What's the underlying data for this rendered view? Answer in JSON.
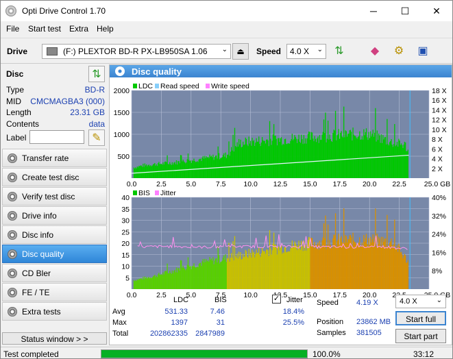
{
  "window": {
    "title": "Opti Drive Control 1.70",
    "minimize": "─",
    "maximize": "☐",
    "close": "✕"
  },
  "menu": [
    "File",
    "Start test",
    "Extra",
    "Help"
  ],
  "toolbar": {
    "drive_label": "Drive",
    "drive_value": "(F:)  PLEXTOR BD-R  PX-LB950SA 1.06",
    "speed_label": "Speed",
    "speed_value": "4.0 X"
  },
  "sidebar": {
    "disc_title": "Disc",
    "info": [
      {
        "k": "Type",
        "v": "BD-R"
      },
      {
        "k": "MID",
        "v": "CMCMAGBA3 (000)"
      },
      {
        "k": "Length",
        "v": "23.31 GB"
      },
      {
        "k": "Contents",
        "v": "data"
      }
    ],
    "label_key": "Label",
    "nav": [
      "Transfer rate",
      "Create test disc",
      "Verify test disc",
      "Drive info",
      "Disc info",
      "Disc quality",
      "CD Bler",
      "FE / TE",
      "Extra tests"
    ],
    "active_index": 5,
    "status_window": "Status window > >"
  },
  "panel": {
    "title": "Disc quality"
  },
  "chart_data": [
    {
      "type": "area",
      "legend": [
        "LDC",
        "Read speed",
        "Write speed"
      ],
      "colors": {
        "LDC": "#00c800",
        "Read speed": "#87cefa",
        "Write speed": "#ff80ff"
      },
      "x_ticks": [
        "0.0",
        "2.5",
        "5.0",
        "7.5",
        "10.0",
        "12.5",
        "15.0",
        "17.5",
        "20.0",
        "22.5",
        "25.0 GB"
      ],
      "y_left_ticks": [
        "2000",
        "1500",
        "1000",
        "500"
      ],
      "y_right_ticks": [
        "18 X",
        "16 X",
        "14 X",
        "12 X",
        "10 X",
        "8 X",
        "6 X",
        "4 X",
        "2 X"
      ],
      "xlim": [
        0,
        25
      ],
      "ylim": [
        0,
        2000
      ],
      "y2lim": [
        0,
        18
      ],
      "ldc_profile": {
        "x": [
          0.2,
          1,
          2,
          3,
          4,
          5,
          6,
          7,
          8,
          9,
          10,
          11,
          12,
          13,
          14,
          15,
          16,
          17,
          18,
          19,
          20,
          21,
          22,
          23,
          23.3
        ],
        "y": [
          250,
          300,
          330,
          350,
          380,
          420,
          460,
          500,
          540,
          820,
          860,
          880,
          900,
          920,
          940,
          960,
          980,
          1000,
          1020,
          1040,
          1040,
          940,
          830,
          780,
          600
        ]
      },
      "read_speed": {
        "x": [
          0,
          23.3
        ],
        "y": [
          1.0,
          4.7
        ]
      }
    },
    {
      "type": "area",
      "legend": [
        "BIS",
        "Jitter"
      ],
      "colors": {
        "BIS": "#00c800",
        "Jitter": "#ff80ff"
      },
      "x_ticks": [
        "0.0",
        "2.5",
        "5.0",
        "7.5",
        "10.0",
        "12.5",
        "15.0",
        "17.5",
        "20.0",
        "22.5",
        "25.0 GB"
      ],
      "y_left_ticks": [
        "40",
        "35",
        "30",
        "25",
        "20",
        "15",
        "10",
        "5"
      ],
      "y_right_ticks": [
        "40%",
        "32%",
        "24%",
        "16%",
        "8%"
      ],
      "xlim": [
        0,
        25
      ],
      "ylim": [
        0,
        40
      ],
      "y2lim": [
        0,
        40
      ],
      "bis_profile": {
        "x": [
          0.2,
          2,
          4,
          6,
          8,
          10,
          12,
          14,
          16,
          18,
          20,
          22,
          23.3
        ],
        "y": [
          4,
          6,
          9,
          12,
          14,
          16,
          18,
          20,
          21,
          22,
          22,
          21,
          12
        ]
      },
      "jitter_pct": {
        "x": [
          0.5,
          3,
          6,
          9,
          12,
          15,
          18,
          21,
          23.3
        ],
        "y": [
          18.4,
          18.6,
          18.3,
          18.5,
          18.6,
          18.4,
          18.3,
          18.5,
          17.5
        ]
      }
    }
  ],
  "stats": {
    "col_ldc": "LDC",
    "col_bis": "BIS",
    "jitter_label": "Jitter",
    "jitter_checked": "✓",
    "rows": [
      {
        "k": "Avg",
        "ldc": "531.33",
        "bis": "7.46",
        "jit": "18.4%"
      },
      {
        "k": "Max",
        "ldc": "1397",
        "bis": "31",
        "jit": "25.5%"
      },
      {
        "k": "Total",
        "ldc": "202862335",
        "bis": "2847989",
        "jit": ""
      }
    ],
    "speed_label": "Speed",
    "speed_value": "4.19 X",
    "speed_select": "4.0 X",
    "position_label": "Position",
    "position_value": "23862 MB",
    "samples_label": "Samples",
    "samples_value": "381505",
    "start_full": "Start full",
    "start_part": "Start part"
  },
  "status": {
    "text": "Test completed",
    "progress": 1.0,
    "progress_text": "100.0%",
    "time": "33:12"
  }
}
